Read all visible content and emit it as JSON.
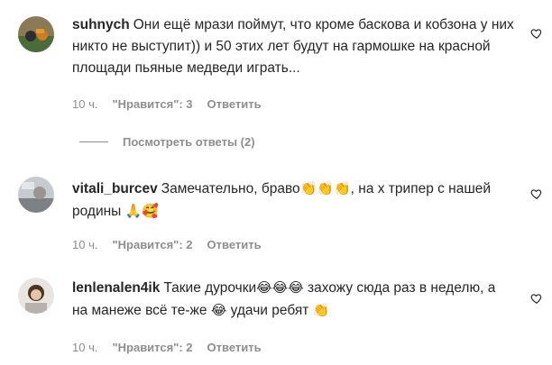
{
  "comments": [
    {
      "username": "suhnych",
      "text": "Они ещё мрази поймут, что кроме баскова и кобзона у них никто не выступит)) и 50 этих лет будут на гармошке на красной площади пьяные медведи играть...",
      "time": "10 ч.",
      "likes": "\"Нравится\": 3",
      "reply": "Ответить"
    },
    {
      "username": "vitali_burcev",
      "text_before": "Замечательно, браво",
      "emoji1": "👏👏👏",
      "text_after": ", на х трипер с нашей родины ",
      "emoji2": "🙏🥰",
      "time": "10 ч.",
      "likes": "\"Нравится\": 2",
      "reply": "Ответить"
    },
    {
      "username": "lenlenalen4ik",
      "text_before": "Такие дурочки",
      "emoji1": "😂😂😂",
      "text_mid": " захожу сюда раз в неделю, а на манеже всё те-же ",
      "emoji2": "😂",
      "text_after": " удачи ребят ",
      "emoji3": "👏",
      "time": "10 ч.",
      "likes": "\"Нравится\": 2",
      "reply": "Ответить"
    }
  ],
  "view_replies": "Посмотреть ответы (2)",
  "icons": {
    "like": "heart-outline-icon"
  }
}
